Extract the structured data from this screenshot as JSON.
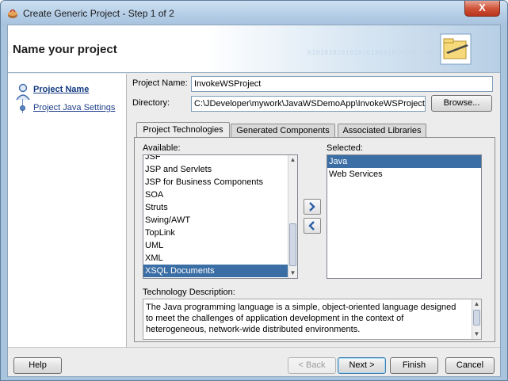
{
  "window": {
    "title": "Create Generic Project - Step 1 of 2",
    "close_glyph": "X"
  },
  "banner": {
    "title": "Name your project",
    "bits": "01010101010101010101010101 0101010101"
  },
  "nav": {
    "items": [
      {
        "label": "Project Name",
        "active": true
      },
      {
        "label": "Project Java Settings",
        "active": false
      }
    ]
  },
  "form": {
    "project_name_label": "Project Name:",
    "project_name_value": "InvokeWSProject",
    "directory_label": "Directory:",
    "directory_value": "C:\\JDeveloper\\mywork\\JavaWSDemoApp\\InvokeWSProject",
    "browse_label": "Browse..."
  },
  "tabs": [
    {
      "label": "Project Technologies",
      "active": true
    },
    {
      "label": "Generated Components",
      "active": false
    },
    {
      "label": "Associated Libraries",
      "active": false
    }
  ],
  "available": {
    "label": "Available:",
    "items": [
      "JSF",
      "JSP and Servlets",
      "JSP for Business Components",
      "SOA",
      "Struts",
      "Swing/AWT",
      "TopLink",
      "UML",
      "XML",
      "XSQL Documents"
    ],
    "selected_index": 9
  },
  "selected": {
    "label": "Selected:",
    "items": [
      "Java",
      "Web Services"
    ],
    "selected_index": 0
  },
  "move": {
    "add_glyph": "»",
    "remove_glyph": "«"
  },
  "description": {
    "label": "Technology Description:",
    "text": "The Java programming language is a simple, object-oriented language designed to meet the challenges of application development in the context of heterogeneous, network-wide distributed environments."
  },
  "footer": {
    "help": "Help",
    "back": "< Back",
    "next": "Next >",
    "finish": "Finish",
    "cancel": "Cancel"
  },
  "colors": {
    "selection": "#3a6ea5",
    "titlebar": "#b8d0e8",
    "close": "#d0553a"
  }
}
